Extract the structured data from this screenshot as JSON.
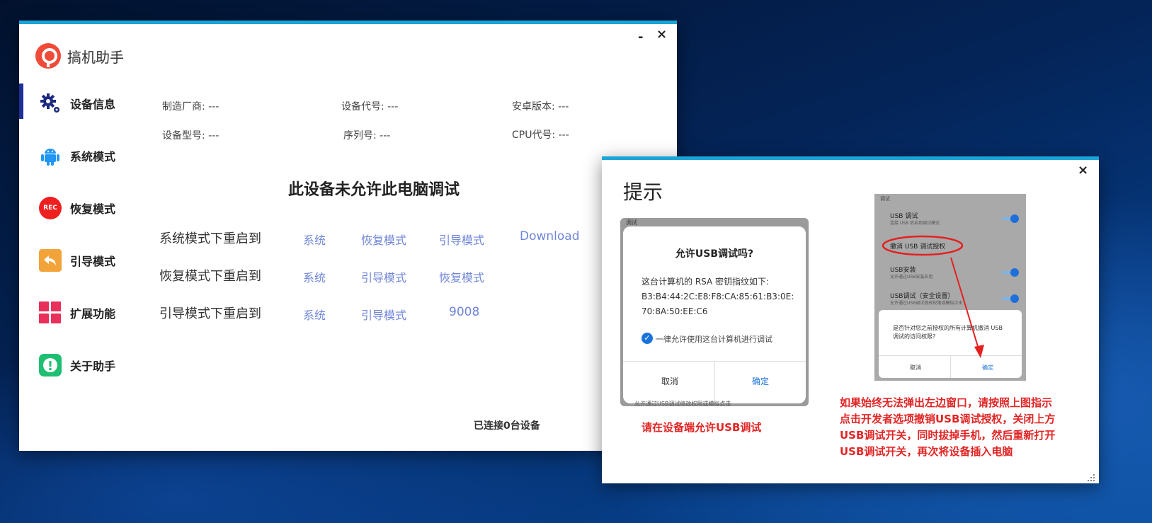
{
  "main_window": {
    "title": "搞机助手",
    "minimize": "-",
    "close": "×",
    "nav": [
      {
        "label": "设备信息",
        "icon": "gear-icon"
      },
      {
        "label": "系统模式",
        "icon": "android-icon"
      },
      {
        "label": "恢复模式",
        "icon": "rec-icon",
        "badge": "REC"
      },
      {
        "label": "引导模式",
        "icon": "back-arrow-icon"
      },
      {
        "label": "扩展功能",
        "icon": "grid-icon"
      },
      {
        "label": "关于助手",
        "icon": "info-icon"
      }
    ],
    "device_info": {
      "manufacturer": "制造厂商: ---",
      "device_code": "设备代号: ---",
      "android_version": "安卓版本: ---",
      "model": "设备型号: ---",
      "serial": "序列号: ---",
      "cpu": "CPU代号: ---"
    },
    "headline": "此设备未允许此电脑调试",
    "reboot_rows": [
      {
        "label": "系统模式下重启到",
        "links": [
          "系统",
          "恢复模式",
          "引导模式",
          "Download"
        ]
      },
      {
        "label": "恢复模式下重启到",
        "links": [
          "系统",
          "引导模式",
          "恢复模式"
        ]
      },
      {
        "label": "引导模式下重启到",
        "links": [
          "系统",
          "引导模式",
          "9008"
        ]
      }
    ],
    "status": "已连接0台设备"
  },
  "tip_window": {
    "title": "提示",
    "close": "×",
    "shot1": {
      "header": "调试",
      "dialog_title": "允许USB调试吗?",
      "body_lines": [
        "这台计算机的 RSA 密钥指纹如下:",
        "B3:B4:44:2C:E8:F8:CA:85:61:B3:0E:",
        "70:8A:50:EE:C6"
      ],
      "checkbox_label": "一律允许使用这台计算机进行调试",
      "cancel": "取消",
      "ok": "确定",
      "footer": "允许通过USB调试修改权限或模拟点击"
    },
    "shot1_caption": "请在设备端允许USB调试",
    "shot2": {
      "header": "调试",
      "items": [
        {
          "title": "USB 调试",
          "sub": "连接 USB 后启用调试模式"
        },
        {
          "title": "撤消 USB 调试授权",
          "sub": ""
        },
        {
          "title": "USB安装",
          "sub": "允许通过USB安装应用"
        },
        {
          "title": "USB调试（安全设置）",
          "sub": "允许通过USB调试修改权限或模拟点击"
        }
      ],
      "dialog_text": "是否针对您之前授权的所有计算机撤消 USB 调试的访问权限?",
      "cancel": "取消",
      "ok": "确定"
    },
    "instructions": [
      "如果始终无法弹出左边窗口，请按照上图指示",
      "点击开发者选项撤销USB调试授权，关闭上方",
      "USB调试开关，同时拔掉手机，然后重新打开",
      "USB调试开关，再次将设备插入电脑"
    ]
  }
}
